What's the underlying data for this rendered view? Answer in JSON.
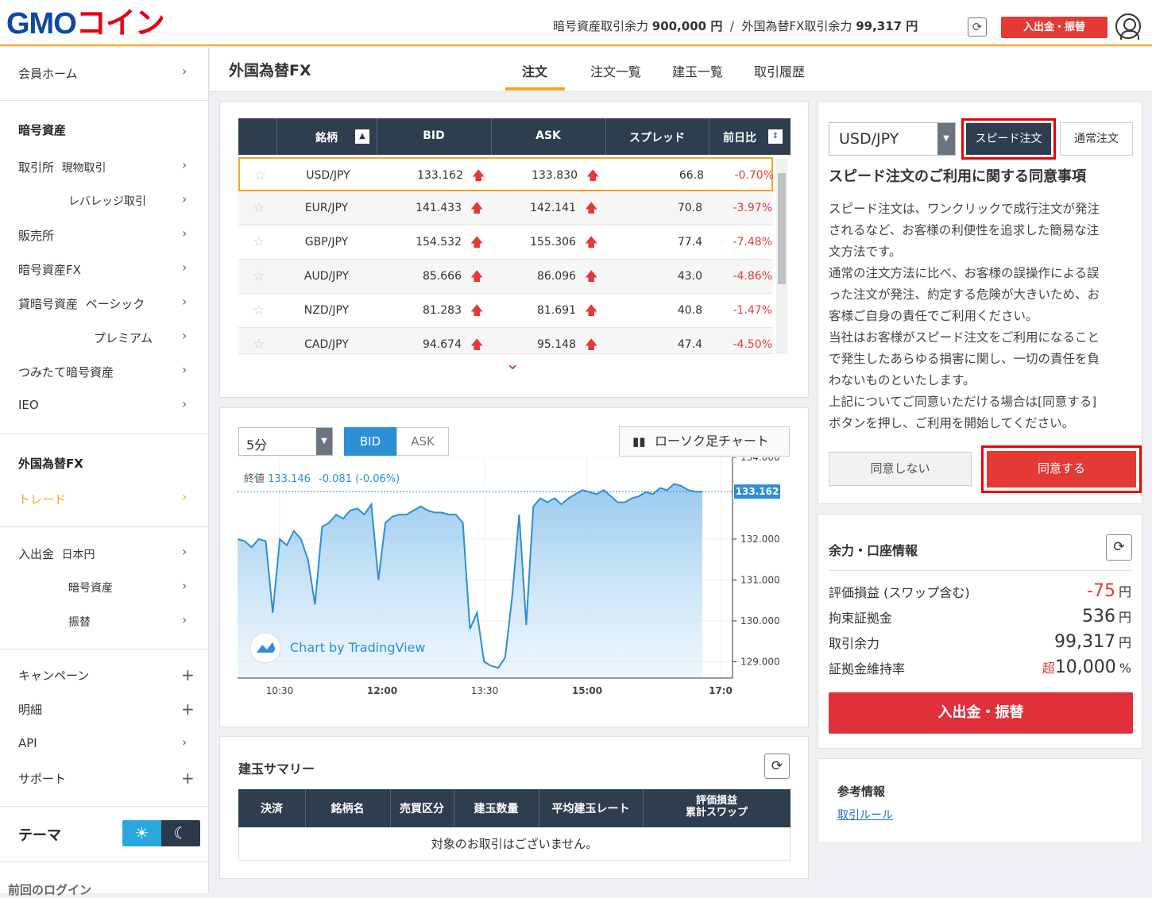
{
  "header": {
    "logo_main": "GMO",
    "logo_sub": "コイン",
    "crypto_label": "暗号資産取引余力",
    "crypto_value": "900,000 円",
    "separator": "/",
    "fx_label": "外国為替FX取引余力",
    "fx_value": "99,317 円",
    "deposit_button": "入出金・振替"
  },
  "sidebar": {
    "member_home": "会員ホーム",
    "crypto_heading": "暗号資産",
    "exchange": "取引所",
    "spot": "現物取引",
    "leverage": "レバレッジ取引",
    "broker": "販売所",
    "crypto_fx": "暗号資産FX",
    "lending": "貸暗号資産",
    "basic": "ベーシック",
    "premium": "プレミアム",
    "tsumitate": "つみたて暗号資産",
    "ieo": "IEO",
    "fx_heading": "外国為替FX",
    "trade": "トレード",
    "deposit": "入出金",
    "jpy": "日本円",
    "crypto_asset": "暗号資産",
    "transfer": "振替",
    "campaign": "キャンペーン",
    "statement": "明細",
    "api": "API",
    "support": "サポート",
    "theme": "テーマ",
    "last_login": "前回のログイン"
  },
  "page": {
    "title": "外国為替FX",
    "tabs": [
      "注文",
      "注文一覧",
      "建玉一覧",
      "取引履歴"
    ]
  },
  "rates": {
    "columns": {
      "symbol": "銘柄",
      "bid": "BID",
      "ask": "ASK",
      "spread": "スプレッド",
      "change": "前日比"
    },
    "rows": [
      {
        "symbol": "USD/JPY",
        "bid": "133.162",
        "ask": "133.830",
        "spread": "66.8",
        "change": "-0.70%"
      },
      {
        "symbol": "EUR/JPY",
        "bid": "141.433",
        "ask": "142.141",
        "spread": "70.8",
        "change": "-3.97%"
      },
      {
        "symbol": "GBP/JPY",
        "bid": "154.532",
        "ask": "155.306",
        "spread": "77.4",
        "change": "-7.48%"
      },
      {
        "symbol": "AUD/JPY",
        "bid": "85.666",
        "ask": "86.096",
        "spread": "43.0",
        "change": "-4.86%"
      },
      {
        "symbol": "NZD/JPY",
        "bid": "81.283",
        "ask": "81.691",
        "spread": "40.8",
        "change": "-1.47%"
      },
      {
        "symbol": "CAD/JPY",
        "bid": "94.674",
        "ask": "95.148",
        "spread": "47.4",
        "change": "-4.50%"
      }
    ]
  },
  "chart_controls": {
    "timeframe": "5分",
    "bid": "BID",
    "ask": "ASK",
    "candle_button": "ローソク足チャート",
    "close_label": "終値",
    "close_value": "133.146",
    "close_change": "-0.081 (-0.06%)",
    "watermark": "Chart by TradingView",
    "current_price": "133.162"
  },
  "chart_data": {
    "type": "area",
    "x_ticks": [
      "10:30",
      "12:00",
      "13:30",
      "15:00",
      "17:0"
    ],
    "y_ticks": [
      "134.000",
      "132.000",
      "131.000",
      "130.000",
      "129.000"
    ],
    "ylim": [
      128.6,
      134.0
    ],
    "values": [
      132.0,
      131.95,
      131.8,
      132.0,
      131.95,
      130.2,
      132.0,
      131.85,
      132.2,
      132.0,
      131.5,
      130.4,
      132.3,
      132.4,
      132.6,
      132.5,
      132.7,
      132.75,
      132.6,
      132.85,
      131.0,
      132.4,
      132.55,
      132.6,
      132.6,
      132.7,
      132.8,
      132.7,
      132.65,
      132.65,
      132.6,
      132.6,
      132.4,
      129.8,
      130.2,
      129.0,
      128.9,
      128.85,
      129.1,
      130.6,
      132.6,
      129.9,
      132.8,
      133.0,
      132.9,
      133.0,
      132.85,
      133.0,
      133.1,
      133.2,
      133.15,
      133.1,
      133.2,
      133.05,
      132.9,
      132.9,
      133.0,
      133.05,
      133.15,
      133.1,
      133.25,
      133.2,
      133.35,
      133.3,
      133.2,
      133.16,
      133.16
    ]
  },
  "summary": {
    "title": "建玉サマリー",
    "columns": [
      "決済",
      "銘柄名",
      "売買区分",
      "建玉数量",
      "平均建玉レート",
      "評価損益",
      "累計スワップ"
    ],
    "empty": "対象のお取引はございません。"
  },
  "order": {
    "pair": "USD/JPY",
    "speed_button": "スピード注文",
    "normal_button": "通常注文",
    "consent_title": "スピード注文のご利用に関する同意事項",
    "consent_lines": [
      "スピード注文は、ワンクリックで成行注文が発注",
      "されるなど、お客様の利便性を追求した簡易な注",
      "文方法です。",
      "通常の注文方法に比べ、お客様の誤操作による誤",
      "った注文が発注、約定する危険が大きいため、お",
      "客様ご自身の責任でご利用ください。",
      "当社はお客様がスピード注文をご利用になること",
      "で発生したあらゆる損害に関し、一切の責任を負",
      "わないものといたします。",
      "上記についてご同意いただける場合は[同意する]",
      "ボタンを押し、ご利用を開始してください。"
    ],
    "disagree": "同意しない",
    "agree": "同意する"
  },
  "account": {
    "title": "余力・口座情報",
    "rows": [
      {
        "label": "評価損益 (スワップ含む)",
        "value": "-75",
        "unit": "円"
      },
      {
        "label": "拘束証拠金",
        "value": "536",
        "unit": "円"
      },
      {
        "label": "取引余力",
        "value": "99,317",
        "unit": "円"
      },
      {
        "label": "証拠金維持率",
        "prefix": "超",
        "value": "10,000",
        "unit": "%"
      }
    ],
    "deposit_button": "入出金・振替"
  },
  "reference": {
    "title": "参考情報",
    "link": "取引ルール"
  },
  "colors": {
    "accent": "#f5a623",
    "red": "#e53935",
    "navy": "#2e3d4f",
    "blue": "#2d8fd6"
  }
}
